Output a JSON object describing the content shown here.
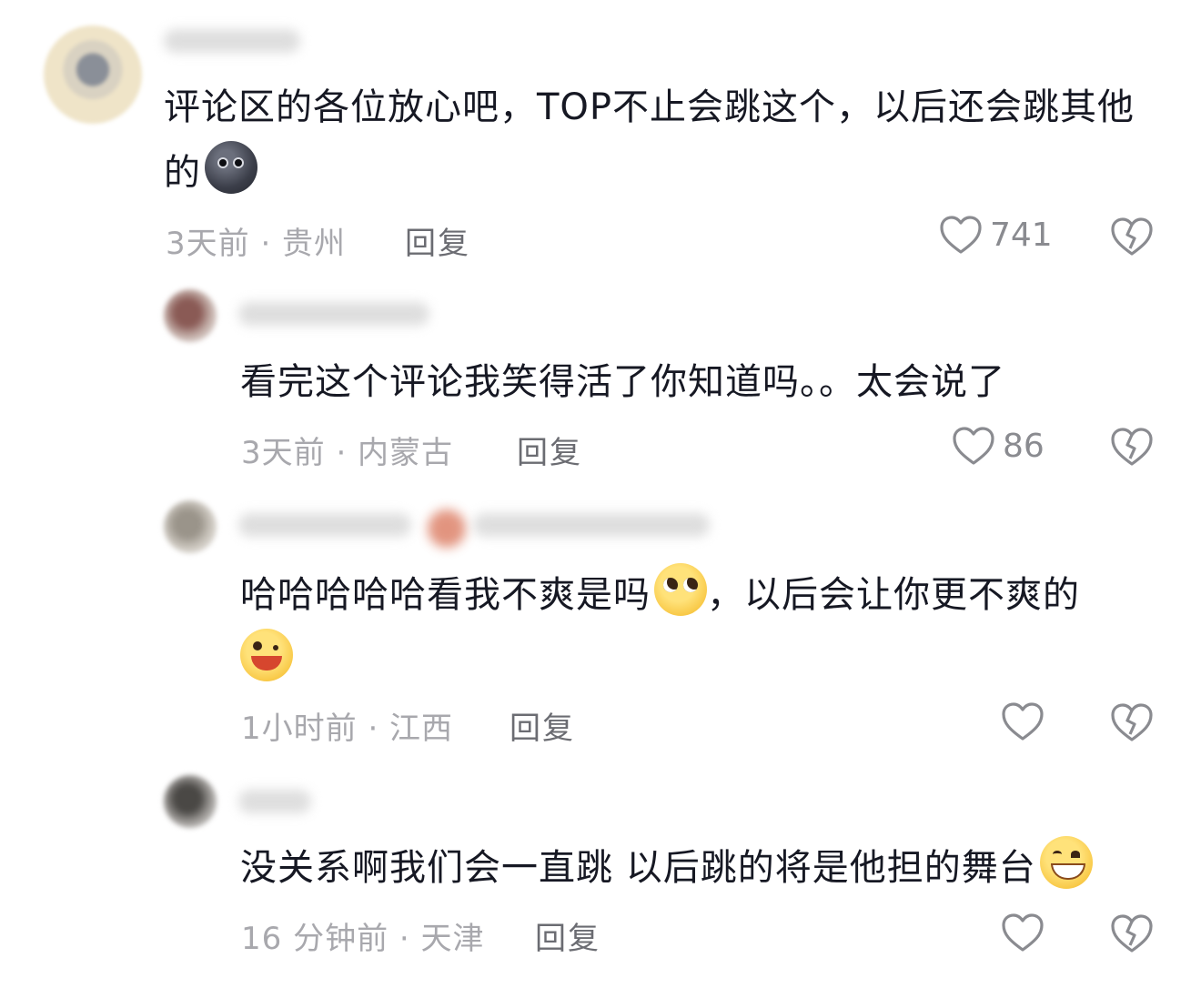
{
  "comments": [
    {
      "text": "评论区的各位放心吧，TOP不止会跳这个，以后还会跳其他的",
      "emoji": "new-moon-face",
      "meta": "3天前 · 贵州",
      "reply": "回复",
      "likes": "741"
    },
    {
      "text": "看完这个评论我笑得活了你知道吗。。太会说了",
      "meta": "3天前 · 内蒙古",
      "reply": "回复",
      "likes": "86"
    },
    {
      "text_a": "哈哈哈哈哈看我不爽是吗",
      "emoji_a": "pleading-face",
      "text_b": "，以后会让你更不爽的",
      "emoji_b": "winking-tongue-face",
      "meta": "1小时前 · 江西",
      "reply": "回复",
      "likes": ""
    },
    {
      "text": "没关系啊我们会一直跳 以后跳的将是他担的舞台",
      "emoji": "grinning-face",
      "meta": "16 分钟前 · 天津",
      "reply": "回复",
      "likes": ""
    }
  ],
  "colors": {
    "text": "#161823",
    "meta": "#a8a8ad",
    "reply": "#6b6c72",
    "icon": "#8a8b90"
  }
}
